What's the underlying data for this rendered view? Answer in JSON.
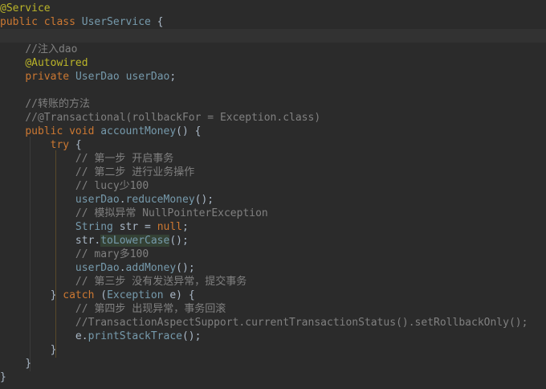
{
  "editor": {
    "colors": {
      "background": "#2b2b2b",
      "text": "#a9b7c6",
      "keyword": "#cc7832",
      "annotation": "#bbb529",
      "comment_gray": "#808080",
      "comment_green": "#629755",
      "function": "#ffc66d",
      "class_ref": "#769aac",
      "current_line": "#323232"
    },
    "lines": [
      {
        "indent": "",
        "tokens": [
          {
            "t": "@Service",
            "c": "ann"
          }
        ]
      },
      {
        "indent": "",
        "tokens": [
          {
            "t": "public class ",
            "c": "kw"
          },
          {
            "t": "UserService",
            "c": "cls"
          },
          {
            "t": " {",
            "c": ""
          }
        ]
      },
      {
        "indent": "",
        "current": true,
        "tokens": []
      },
      {
        "indent": "    ",
        "tokens": [
          {
            "t": "//注入dao",
            "c": "cm"
          }
        ]
      },
      {
        "indent": "    ",
        "tokens": [
          {
            "t": "@Autowired",
            "c": "ann"
          }
        ]
      },
      {
        "indent": "    ",
        "tokens": [
          {
            "t": "private ",
            "c": "kw"
          },
          {
            "t": "UserDao ",
            "c": "cls"
          },
          {
            "t": "userDao",
            "c": "cls"
          },
          {
            "t": ";",
            "c": ""
          }
        ]
      },
      {
        "indent": "",
        "tokens": []
      },
      {
        "indent": "    ",
        "tokens": [
          {
            "t": "//转账的方法",
            "c": "cm"
          }
        ]
      },
      {
        "indent": "    ",
        "tokens": [
          {
            "t": "//@Transactional(rollbackFor = Exception.class)",
            "c": "cm"
          }
        ]
      },
      {
        "indent": "    ",
        "tokens": [
          {
            "t": "public void ",
            "c": "kw"
          },
          {
            "t": "accountMoney",
            "c": "cls"
          },
          {
            "t": "() {",
            "c": ""
          }
        ]
      },
      {
        "indent": "        ",
        "tokens": [
          {
            "t": "try",
            "c": "kw"
          },
          {
            "t": " {",
            "c": ""
          }
        ]
      },
      {
        "indent": "            ",
        "tokens": [
          {
            "t": "// 第一步 开启事务",
            "c": "cm"
          }
        ]
      },
      {
        "indent": "            ",
        "tokens": [
          {
            "t": "// 第二步 进行业务操作",
            "c": "cm"
          }
        ]
      },
      {
        "indent": "            ",
        "tokens": [
          {
            "t": "// lucy少100",
            "c": "cm"
          }
        ]
      },
      {
        "indent": "            ",
        "tokens": [
          {
            "t": "userDao",
            "c": "cls"
          },
          {
            "t": ".",
            "c": ""
          },
          {
            "t": "reduceMoney",
            "c": "cls"
          },
          {
            "t": "();",
            "c": ""
          }
        ]
      },
      {
        "indent": "            ",
        "tokens": [
          {
            "t": "// 模拟异常 NullPointerException",
            "c": "cm"
          }
        ]
      },
      {
        "indent": "            ",
        "tokens": [
          {
            "t": "String ",
            "c": "cls"
          },
          {
            "t": "str = ",
            "c": ""
          },
          {
            "t": "null",
            "c": "kw"
          },
          {
            "t": ";",
            "c": ""
          }
        ]
      },
      {
        "indent": "            ",
        "tokens": [
          {
            "t": "str.",
            "c": ""
          },
          {
            "t": "toLowerCase",
            "c": "cls hl"
          },
          {
            "t": "();",
            "c": ""
          }
        ]
      },
      {
        "indent": "            ",
        "tokens": [
          {
            "t": "// mary多100",
            "c": "cm"
          }
        ]
      },
      {
        "indent": "            ",
        "tokens": [
          {
            "t": "userDao",
            "c": "cls"
          },
          {
            "t": ".",
            "c": ""
          },
          {
            "t": "addMoney",
            "c": "cls"
          },
          {
            "t": "();",
            "c": ""
          }
        ]
      },
      {
        "indent": "            ",
        "tokens": [
          {
            "t": "// 第三步 没有发送异常，提交事务",
            "c": "cm"
          }
        ]
      },
      {
        "indent": "        ",
        "tokens": [
          {
            "t": "} ",
            "c": ""
          },
          {
            "t": "catch",
            "c": "kw"
          },
          {
            "t": " (",
            "c": ""
          },
          {
            "t": "Exception ",
            "c": "cls"
          },
          {
            "t": "e) {",
            "c": ""
          }
        ]
      },
      {
        "indent": "            ",
        "tokens": [
          {
            "t": "// 第四步 出现异常，事务回滚",
            "c": "cm"
          }
        ]
      },
      {
        "indent": "            ",
        "tokens": [
          {
            "t": "//TransactionAspectSupport.currentTransactionStatus().setRollbackOnly();",
            "c": "cm"
          }
        ]
      },
      {
        "indent": "            ",
        "tokens": [
          {
            "t": "e.",
            "c": ""
          },
          {
            "t": "printStackTrace",
            "c": "cls"
          },
          {
            "t": "();",
            "c": ""
          }
        ]
      },
      {
        "indent": "        ",
        "tokens": [
          {
            "t": "}",
            "c": ""
          }
        ]
      },
      {
        "indent": "    ",
        "tokens": [
          {
            "t": "}",
            "c": ""
          }
        ]
      },
      {
        "indent": "",
        "tokens": [
          {
            "t": "}",
            "c": ""
          }
        ]
      }
    ]
  }
}
